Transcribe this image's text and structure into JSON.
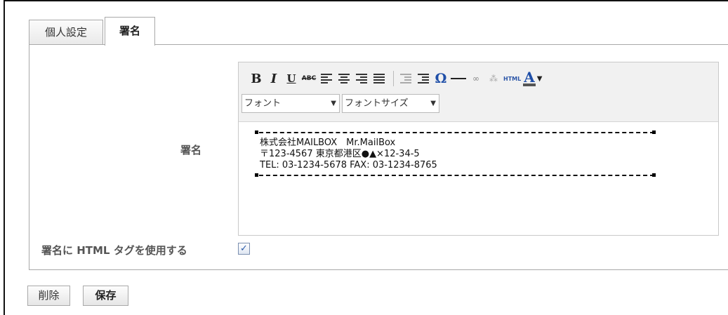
{
  "tabs": [
    {
      "label": "個人設定"
    },
    {
      "label": "署名"
    }
  ],
  "form": {
    "signature_label": "署名",
    "html_tag_label": "署名に HTML タグを使用する",
    "html_tag_checked": true
  },
  "toolbar": {
    "bold_label": "B",
    "italic_label": "I",
    "underline_label": "U",
    "strike_label": "ABC",
    "special_char_label": "Ω",
    "html_label": "HTML",
    "font_color_label": "A",
    "font_select": "フォント",
    "font_size_select": "フォントサイズ",
    "icons": [
      "align-left-icon",
      "align-center-icon",
      "align-right-icon",
      "align-justify-icon",
      "outdent-icon",
      "indent-icon",
      "special-char-icon",
      "horizontal-rule-icon",
      "link-icon",
      "unlink-icon",
      "html-source-icon",
      "font-color-icon"
    ]
  },
  "signature": {
    "lines": [
      "株式会社MAILBOX　Mr.MailBox",
      "〒123-4567 東京都港区●▲×12-34-5",
      "TEL: 03-1234-5678 FAX: 03-1234-8765"
    ]
  },
  "buttons": {
    "delete_label": "削除",
    "save_label": "保存"
  }
}
